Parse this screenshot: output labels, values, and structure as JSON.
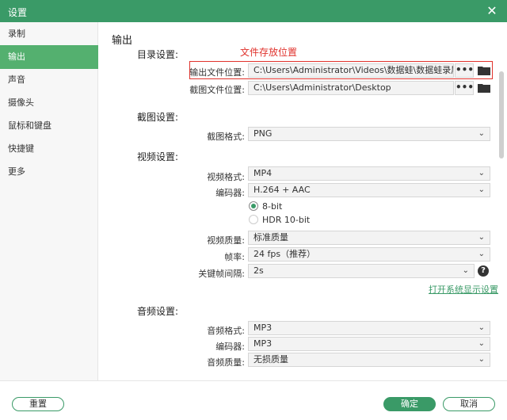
{
  "window": {
    "title": "设置",
    "close_glyph": "✕"
  },
  "sidebar": {
    "items": [
      {
        "label": "录制"
      },
      {
        "label": "输出"
      },
      {
        "label": "声音"
      },
      {
        "label": "摄像头"
      },
      {
        "label": "鼠标和键盘"
      },
      {
        "label": "快捷键"
      },
      {
        "label": "更多"
      }
    ],
    "active_index": 1
  },
  "main": {
    "title": "输出",
    "directory": {
      "heading": "目录设置:",
      "annotation": "文件存放位置",
      "output_label": "输出文件位置:",
      "output_path": "C:\\Users\\Administrator\\Videos\\数据蛙\\数据蛙录屏软件",
      "screenshot_label": "截图文件位置:",
      "screenshot_path": "C:\\Users\\Administrator\\Desktop",
      "more_glyph": "•••"
    },
    "screenshot": {
      "heading": "截图设置:",
      "format_label": "截图格式:",
      "format_value": "PNG"
    },
    "video": {
      "heading": "视频设置:",
      "format_label": "视频格式:",
      "format_value": "MP4",
      "encoder_label": "编码器:",
      "encoder_value": "H.264 + AAC",
      "bit_8": "8-bit",
      "bit_hdr": "HDR 10-bit",
      "quality_label": "视频质量:",
      "quality_value": "标准质量",
      "fps_label": "帧率:",
      "fps_value": "24 fps（推荐）",
      "keyframe_label": "关键帧间隔:",
      "keyframe_value": "2s",
      "display_link": "打开系统显示设置"
    },
    "audio": {
      "heading": "音频设置:",
      "format_label": "音频格式:",
      "format_value": "MP3",
      "encoder_label": "编码器:",
      "encoder_value": "MP3",
      "quality_label": "音频质量:",
      "quality_value": "无损质量"
    }
  },
  "footer": {
    "reset_label": "重置",
    "ok_label": "确定",
    "cancel_label": "取消"
  },
  "colors": {
    "accent": "#3a9a67",
    "sidebar_active": "#54b06f",
    "annotation": "#e0322c"
  }
}
